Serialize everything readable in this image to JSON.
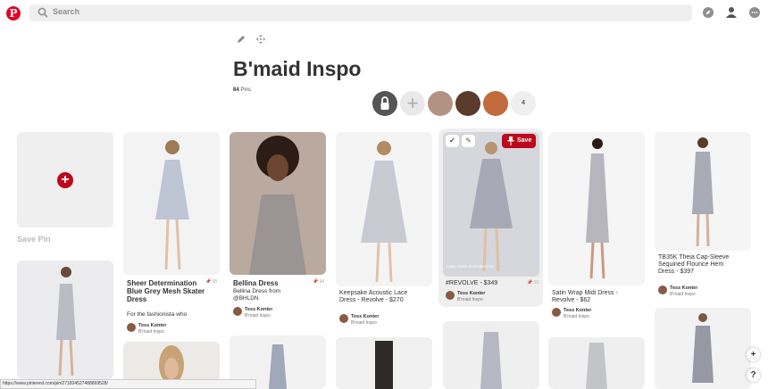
{
  "header": {
    "logo": "P",
    "search_placeholder": "Search"
  },
  "board": {
    "title": "B'maid Inspo",
    "pin_count": "84",
    "pins_label": "Pins",
    "collab_more": "4"
  },
  "save_pin": {
    "label": "Save Pin"
  },
  "pins": [
    {
      "id": "p1",
      "title": "Sheer Determination Blue Grey Mesh Skater Dress",
      "desc": "For the fashionista who",
      "repins": "38",
      "author": "Tess Konter",
      "board": "B'maid Inspo",
      "color": "#dfe3ea"
    },
    {
      "id": "p2",
      "title": "Bellina Dress",
      "desc": "Bellina Dress from @BHLDN",
      "repins": "34",
      "author": "Tess Konter",
      "board": "B'maid Inspo",
      "color": "#c9c4c1"
    },
    {
      "id": "p3",
      "title": "Keepsake Acoustic Lace Dress - Revolve - $270",
      "author": "Tess Konter",
      "board": "B'maid Inspo",
      "color": "#e6e7ea"
    },
    {
      "id": "p4",
      "title": "#REVOLVE - $349",
      "repins": "10",
      "author": "Tess Konter",
      "board": "B'maid Inspo",
      "learn_more": "Learn more at revolve.com",
      "save": "Save",
      "color": "#c9ccd4"
    },
    {
      "id": "p5",
      "title": "Satin Wrap Midi Dress - Revolve - $62",
      "author": "Tess Konter",
      "board": "B'maid Inspo",
      "color": "#e8e8ea"
    },
    {
      "id": "p6",
      "title": "TB35K Theia Cap-Sleeve Sequined Flounce Hem Dress - $397",
      "author": "Tess Konter",
      "board": "B'maid Inspo",
      "color": "#e9eaee"
    }
  ],
  "status_url": "https://www.pinterest.com/pin/271834527488869528/",
  "fab": {
    "plus": "+",
    "help": "?"
  }
}
